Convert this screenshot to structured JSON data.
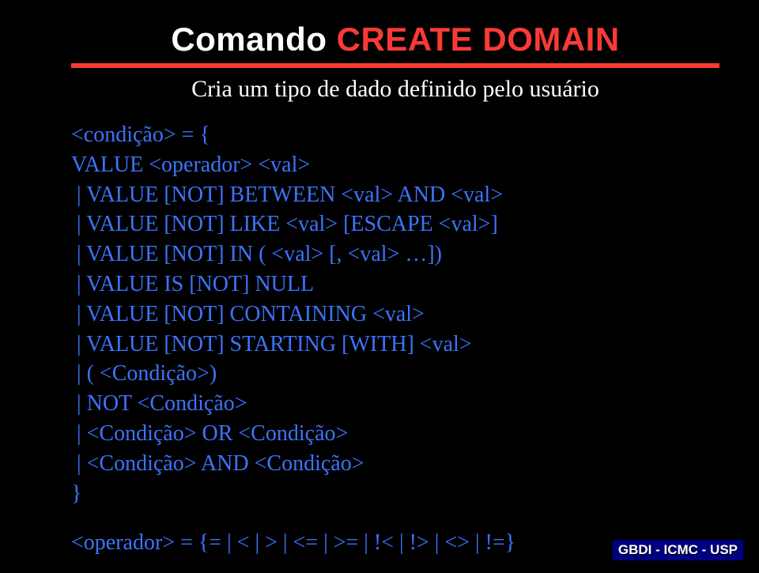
{
  "title": {
    "part1": "Comando ",
    "part2": "CREATE DOMAIN"
  },
  "subtitle": "Cria um tipo de dado definido pelo usuário",
  "syntax": {
    "lines": [
      "<condição> = {",
      "VALUE <operador> <val>",
      " | VALUE [NOT] BETWEEN <val> AND <val>",
      " | VALUE [NOT] LIKE <val> [ESCAPE <val>]",
      " | VALUE [NOT] IN ( <val> [, <val> …])",
      " | VALUE IS [NOT] NULL",
      " | VALUE [NOT] CONTAINING <val>",
      " | VALUE [NOT] STARTING [WITH] <val>",
      " | ( <Condição>)",
      " | NOT <Condição>",
      " | <Condição> OR <Condição>",
      " | <Condição> AND <Condição>",
      "}"
    ]
  },
  "operator_line": "<operador> = {= | < | > | <= | >= | !< | !> | <> | !=}",
  "footer": "GBDI - ICMC - USP"
}
